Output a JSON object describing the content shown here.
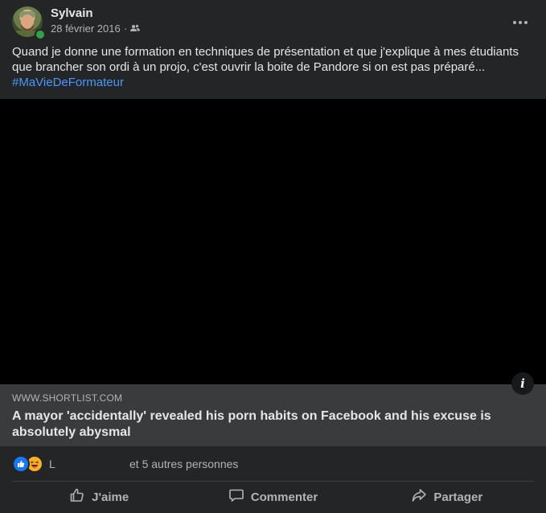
{
  "post": {
    "author": "Sylvain",
    "date": "28 février 2016",
    "date_separator": "·",
    "audience_icon": "friends-icon",
    "more_icon": "more-horizontal-icon",
    "text": "Quand je donne une formation en techniques de présentation et que j'explique à mes étudiants que brancher son ordi à un projo, c'est ouvrir la boite de Pandore si on est pas préparé...",
    "hashtag": "#MaVieDeFormateur"
  },
  "media": {
    "info_label": "i"
  },
  "link_preview": {
    "domain": "WWW.SHORTLIST.COM",
    "title": "A mayor 'accidentally' revealed his porn habits on Facebook and his excuse is absolutely abysmal"
  },
  "reactions": {
    "icons": [
      "like-reaction-icon",
      "haha-reaction-icon"
    ],
    "first_reactor": "L",
    "others": "et 5 autres personnes"
  },
  "actions": [
    {
      "label": "J'aime",
      "icon": "thumbs-up-icon"
    },
    {
      "label": "Commenter",
      "icon": "comment-icon"
    },
    {
      "label": "Partager",
      "icon": "share-icon"
    }
  ],
  "colors": {
    "background": "#242526",
    "text": "#e4e6eb",
    "secondary_text": "#b0b3b8",
    "link_blue": "#4599ff",
    "online_green": "#31a24c",
    "like_blue": "#1877f2",
    "haha_yellow": "#f7b125"
  }
}
